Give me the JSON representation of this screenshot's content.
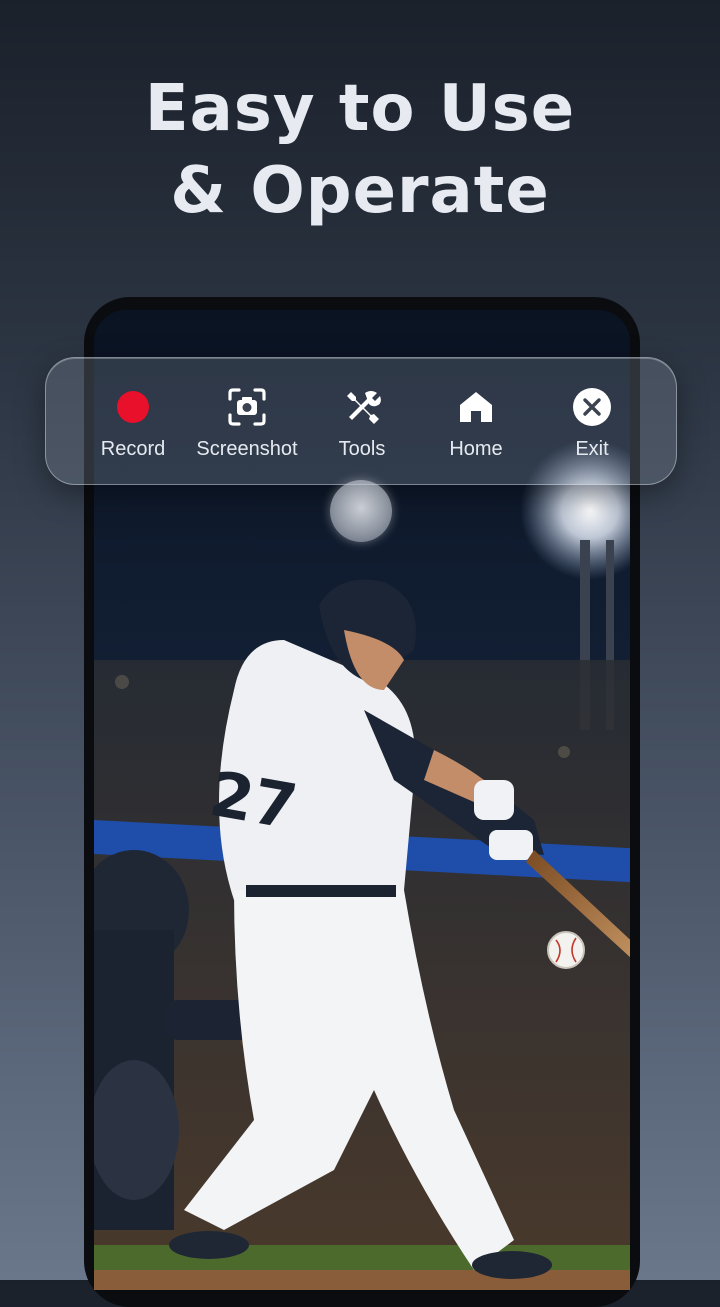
{
  "headline": {
    "line1": "Easy to Use",
    "line2": "& Operate"
  },
  "toolbar": {
    "items": [
      {
        "label": "Record",
        "icon": "record-dot-icon",
        "color": "#e8102a"
      },
      {
        "label": "Screenshot",
        "icon": "screenshot-camera-icon"
      },
      {
        "label": "Tools",
        "icon": "wrench-screwdriver-icon"
      },
      {
        "label": "Home",
        "icon": "home-icon"
      },
      {
        "label": "Exit",
        "icon": "close-circle-icon"
      }
    ]
  },
  "scene": {
    "jersey_number": "27"
  },
  "colors": {
    "record": "#e8102a",
    "label": "#e6eaf0",
    "headline": "#e7ebf1"
  }
}
